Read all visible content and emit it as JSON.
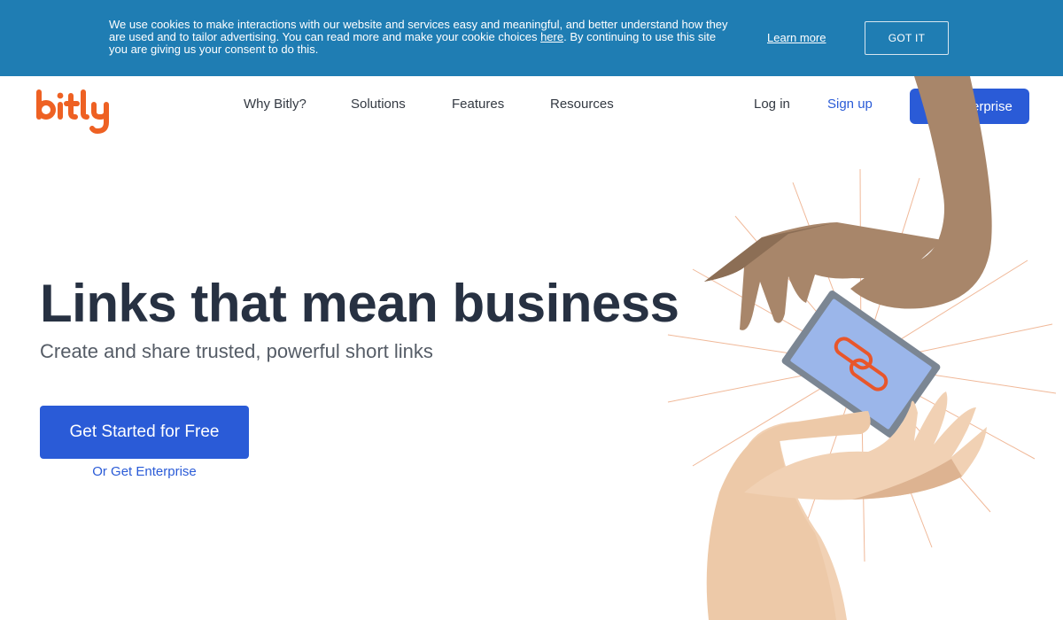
{
  "cookie_banner": {
    "text_part1": "We use cookies to make interactions with our website and services easy and meaningful, and better understand how they are used and to tailor advertising. You can read more and make your cookie choices ",
    "link_here": "here",
    "text_part2": ". By continuing to use this site you are giving us your consent to do this.",
    "learn_more": "Learn more",
    "got_it": "GOT IT"
  },
  "header": {
    "logo_text": "bitly",
    "nav": [
      "Why Bitly?",
      "Solutions",
      "Features",
      "Resources"
    ],
    "login": "Log in",
    "signup": "Sign up",
    "enterprise_button": "Get Enterprise"
  },
  "hero": {
    "title": "Links that mean business",
    "subtitle": "Create and share trusted, powerful short links",
    "cta": "Get Started for Free",
    "cta_alt": "Or Get Enterprise"
  },
  "illustration": {
    "icon": "hands-passing-phone-with-link-icon"
  },
  "colors": {
    "banner": "#1f7db3",
    "accent_blue": "#2a5bd7",
    "logo_orange": "#ee6123",
    "heading": "#273142"
  }
}
